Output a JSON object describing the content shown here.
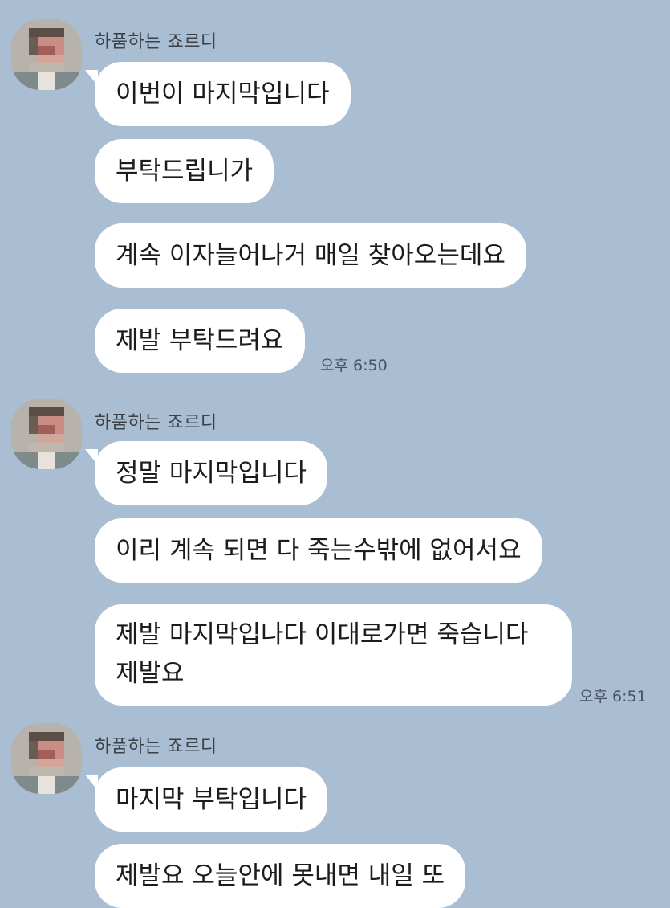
{
  "chat": {
    "groups": [
      {
        "sender": "하품하는 죠르디",
        "messages": [
          "이번이 마지막입니다",
          "부탁드립니가",
          "계속 이자늘어나거 매일 찾아오는데요",
          "제발 부탁드려요"
        ],
        "time": "오후 6:50"
      },
      {
        "sender": "하품하는 죠르디",
        "messages": [
          "정말 마지막입니다",
          "이리 계속 되면 다 죽는수밖에 없어서요",
          "제발 마지막입나다 이대로가면 죽습니다 제발요"
        ],
        "time": "오후 6:51"
      },
      {
        "sender": "하품하는 죠르디",
        "messages": [
          "마지막 부탁입니다",
          "제발요 오늘안에 못내면 내일 또"
        ],
        "time": ""
      }
    ],
    "avatar_icon": "blurred-profile-avatar-icon",
    "colors": {
      "background": "#a9bdd3",
      "bubble": "#ffffff",
      "text": "#1c1c1c"
    }
  }
}
